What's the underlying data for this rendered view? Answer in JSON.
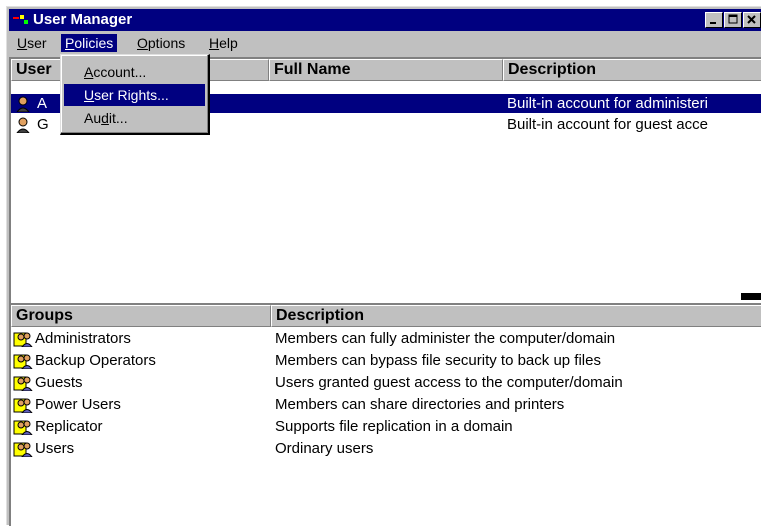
{
  "window": {
    "title": "User Manager"
  },
  "menubar": [
    {
      "label": "User",
      "u": "U",
      "rest": "ser"
    },
    {
      "label": "Policies",
      "u": "P",
      "rest": "olicies"
    },
    {
      "label": "Options",
      "u": "O",
      "rest": "ptions"
    },
    {
      "label": "Help",
      "u": "H",
      "rest": "elp"
    }
  ],
  "policies_menu": {
    "items": [
      {
        "pre": "",
        "u": "A",
        "post": "ccount..."
      },
      {
        "pre": "",
        "u": "U",
        "post": "ser Rights..."
      },
      {
        "pre": "Au",
        "u": "d",
        "post": "it..."
      }
    ]
  },
  "users_table": {
    "headers": {
      "username": "User",
      "fullname": "Full Name",
      "description": "Description"
    },
    "rows": [
      {
        "username": "A",
        "fullname": "",
        "description": "Built-in account for administeri"
      },
      {
        "username": "G",
        "fullname": "",
        "description": "Built-in account for guest acce"
      }
    ]
  },
  "groups_table": {
    "headers": {
      "group": "Groups",
      "description": "Description"
    },
    "rows": [
      {
        "group": "Administrators",
        "description": "Members can fully administer the computer/domain"
      },
      {
        "group": "Backup Operators",
        "description": "Members can bypass file security to back up files"
      },
      {
        "group": "Guests",
        "description": "Users granted guest access to the computer/domain"
      },
      {
        "group": "Power Users",
        "description": "Members can share directories and printers"
      },
      {
        "group": "Replicator",
        "description": "Supports file replication in a domain"
      },
      {
        "group": "Users",
        "description": "Ordinary users"
      }
    ]
  },
  "icons": {
    "app": "user-manager-icon",
    "user": "user-icon",
    "group": "group-icon"
  },
  "colors": {
    "selection": "#000080",
    "face": "#c0c0c0"
  }
}
